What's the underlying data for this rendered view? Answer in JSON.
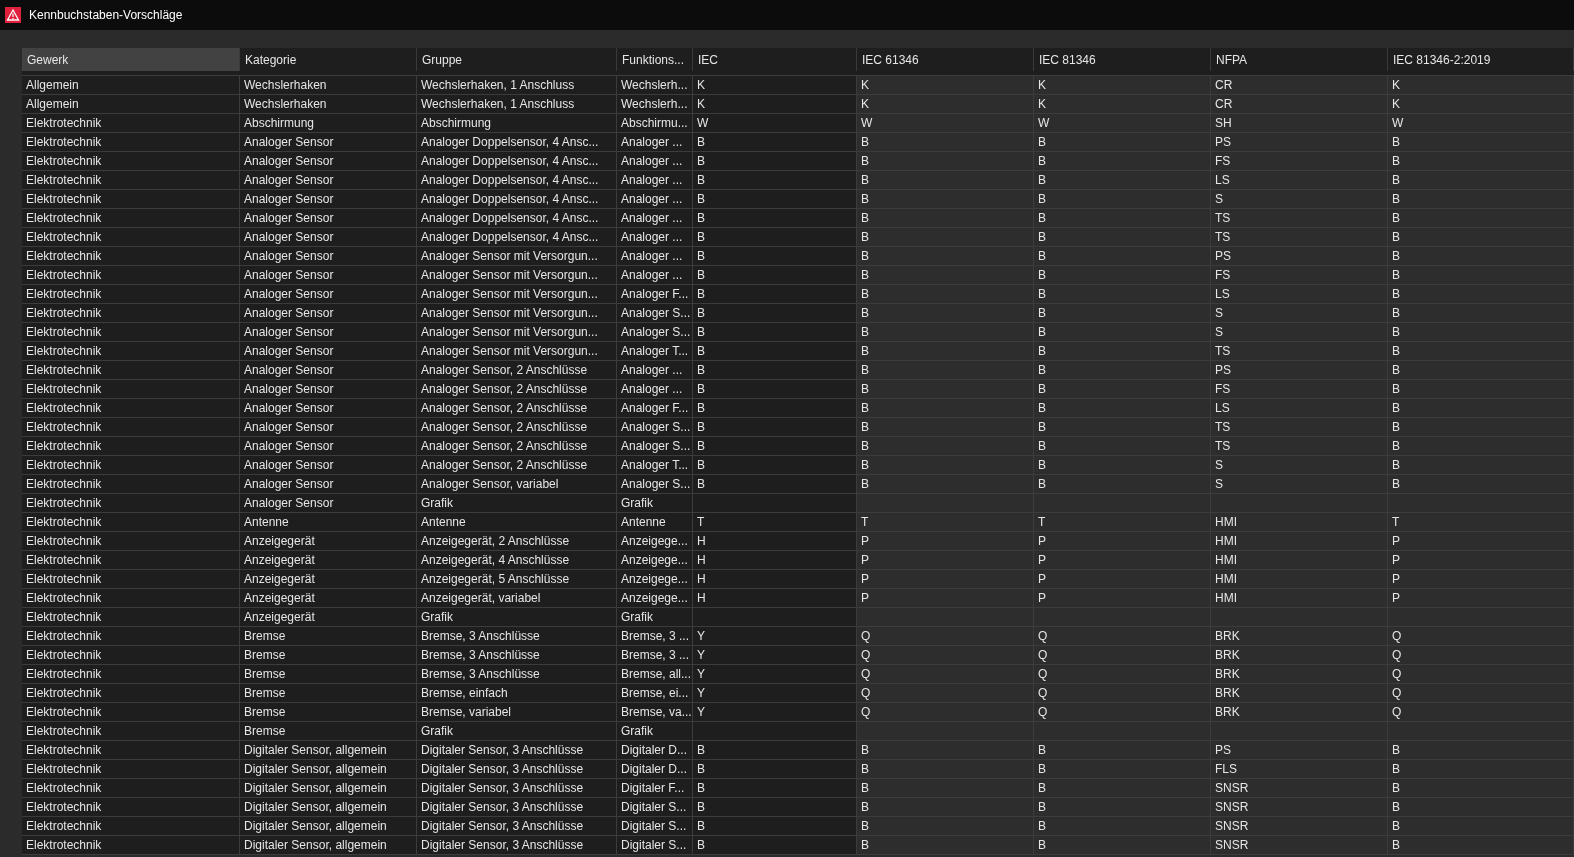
{
  "window": {
    "title": "Kennbuchstaben-Vorschläge"
  },
  "table": {
    "columns": [
      {
        "label": "Gewerk",
        "selected": true
      },
      {
        "label": "Kategorie",
        "selected": false
      },
      {
        "label": "Gruppe",
        "selected": false
      },
      {
        "label": "Funktions...",
        "selected": false
      },
      {
        "label": "IEC",
        "selected": false
      },
      {
        "label": "IEC 61346",
        "selected": false
      },
      {
        "label": "IEC 81346",
        "selected": false
      },
      {
        "label": "NFPA",
        "selected": false
      },
      {
        "label": "IEC 81346-2:2019",
        "selected": false
      }
    ],
    "rows": [
      [
        "Allgemein",
        "Wechslerhaken",
        "Wechslerhaken, 1 Anschluss",
        "Wechslerh...",
        "K",
        "K",
        "K",
        "CR",
        "K"
      ],
      [
        "Allgemein",
        "Wechslerhaken",
        "Wechslerhaken, 1 Anschluss",
        "Wechslerh...",
        "K",
        "K",
        "K",
        "CR",
        "K"
      ],
      [
        "Elektrotechnik",
        "Abschirmung",
        "Abschirmung",
        "Abschirmu...",
        "W",
        "W",
        "W",
        "SH",
        "W"
      ],
      [
        "Elektrotechnik",
        "Analoger Sensor",
        "Analoger Doppelsensor, 4 Ansc...",
        "Analoger ...",
        "B",
        "B",
        "B",
        "PS",
        "B"
      ],
      [
        "Elektrotechnik",
        "Analoger Sensor",
        "Analoger Doppelsensor, 4 Ansc...",
        "Analoger ...",
        "B",
        "B",
        "B",
        "FS",
        "B"
      ],
      [
        "Elektrotechnik",
        "Analoger Sensor",
        "Analoger Doppelsensor, 4 Ansc...",
        "Analoger ...",
        "B",
        "B",
        "B",
        "LS",
        "B"
      ],
      [
        "Elektrotechnik",
        "Analoger Sensor",
        "Analoger Doppelsensor, 4 Ansc...",
        "Analoger ...",
        "B",
        "B",
        "B",
        "S",
        "B"
      ],
      [
        "Elektrotechnik",
        "Analoger Sensor",
        "Analoger Doppelsensor, 4 Ansc...",
        "Analoger ...",
        "B",
        "B",
        "B",
        "TS",
        "B"
      ],
      [
        "Elektrotechnik",
        "Analoger Sensor",
        "Analoger Doppelsensor, 4 Ansc...",
        "Analoger ...",
        "B",
        "B",
        "B",
        "TS",
        "B"
      ],
      [
        "Elektrotechnik",
        "Analoger Sensor",
        "Analoger Sensor mit Versorgun...",
        "Analoger ...",
        "B",
        "B",
        "B",
        "PS",
        "B"
      ],
      [
        "Elektrotechnik",
        "Analoger Sensor",
        "Analoger Sensor mit Versorgun...",
        "Analoger ...",
        "B",
        "B",
        "B",
        "FS",
        "B"
      ],
      [
        "Elektrotechnik",
        "Analoger Sensor",
        "Analoger Sensor mit Versorgun...",
        "Analoger F...",
        "B",
        "B",
        "B",
        "LS",
        "B"
      ],
      [
        "Elektrotechnik",
        "Analoger Sensor",
        "Analoger Sensor mit Versorgun...",
        "Analoger S...",
        "B",
        "B",
        "B",
        "S",
        "B"
      ],
      [
        "Elektrotechnik",
        "Analoger Sensor",
        "Analoger Sensor mit Versorgun...",
        "Analoger S...",
        "B",
        "B",
        "B",
        "S",
        "B"
      ],
      [
        "Elektrotechnik",
        "Analoger Sensor",
        "Analoger Sensor mit Versorgun...",
        "Analoger T...",
        "B",
        "B",
        "B",
        "TS",
        "B"
      ],
      [
        "Elektrotechnik",
        "Analoger Sensor",
        "Analoger Sensor, 2 Anschlüsse",
        "Analoger ...",
        "B",
        "B",
        "B",
        "PS",
        "B"
      ],
      [
        "Elektrotechnik",
        "Analoger Sensor",
        "Analoger Sensor, 2 Anschlüsse",
        "Analoger ...",
        "B",
        "B",
        "B",
        "FS",
        "B"
      ],
      [
        "Elektrotechnik",
        "Analoger Sensor",
        "Analoger Sensor, 2 Anschlüsse",
        "Analoger F...",
        "B",
        "B",
        "B",
        "LS",
        "B"
      ],
      [
        "Elektrotechnik",
        "Analoger Sensor",
        "Analoger Sensor, 2 Anschlüsse",
        "Analoger S...",
        "B",
        "B",
        "B",
        "TS",
        "B"
      ],
      [
        "Elektrotechnik",
        "Analoger Sensor",
        "Analoger Sensor, 2 Anschlüsse",
        "Analoger S...",
        "B",
        "B",
        "B",
        "TS",
        "B"
      ],
      [
        "Elektrotechnik",
        "Analoger Sensor",
        "Analoger Sensor, 2 Anschlüsse",
        "Analoger T...",
        "B",
        "B",
        "B",
        "S",
        "B"
      ],
      [
        "Elektrotechnik",
        "Analoger Sensor",
        "Analoger Sensor, variabel",
        "Analoger S...",
        "B",
        "B",
        "B",
        "S",
        "B"
      ],
      [
        "Elektrotechnik",
        "Analoger Sensor",
        "Grafik",
        "Grafik",
        null,
        null,
        null,
        null,
        null
      ],
      [
        "Elektrotechnik",
        "Antenne",
        "Antenne",
        "Antenne",
        "T",
        "T",
        "T",
        "HMI",
        "T"
      ],
      [
        "Elektrotechnik",
        "Anzeigegerät",
        "Anzeigegerät, 2 Anschlüsse",
        "Anzeigege...",
        "H",
        "P",
        "P",
        "HMI",
        "P"
      ],
      [
        "Elektrotechnik",
        "Anzeigegerät",
        "Anzeigegerät, 4 Anschlüsse",
        "Anzeigege...",
        "H",
        "P",
        "P",
        "HMI",
        "P"
      ],
      [
        "Elektrotechnik",
        "Anzeigegerät",
        "Anzeigegerät, 5 Anschlüsse",
        "Anzeigege...",
        "H",
        "P",
        "P",
        "HMI",
        "P"
      ],
      [
        "Elektrotechnik",
        "Anzeigegerät",
        "Anzeigegerät, variabel",
        "Anzeigege...",
        "H",
        "P",
        "P",
        "HMI",
        "P"
      ],
      [
        "Elektrotechnik",
        "Anzeigegerät",
        "Grafik",
        "Grafik",
        null,
        null,
        null,
        null,
        null
      ],
      [
        "Elektrotechnik",
        "Bremse",
        "Bremse, 3 Anschlüsse",
        "Bremse, 3 ...",
        "Y",
        "Q",
        "Q",
        "BRK",
        "Q"
      ],
      [
        "Elektrotechnik",
        "Bremse",
        "Bremse, 3 Anschlüsse",
        "Bremse, 3 ...",
        "Y",
        "Q",
        "Q",
        "BRK",
        "Q"
      ],
      [
        "Elektrotechnik",
        "Bremse",
        "Bremse, 3 Anschlüsse",
        "Bremse, all...",
        "Y",
        "Q",
        "Q",
        "BRK",
        "Q"
      ],
      [
        "Elektrotechnik",
        "Bremse",
        "Bremse, einfach",
        "Bremse, ei...",
        "Y",
        "Q",
        "Q",
        "BRK",
        "Q"
      ],
      [
        "Elektrotechnik",
        "Bremse",
        "Bremse, variabel",
        "Bremse, va...",
        "Y",
        "Q",
        "Q",
        "BRK",
        "Q"
      ],
      [
        "Elektrotechnik",
        "Bremse",
        "Grafik",
        "Grafik",
        null,
        null,
        null,
        null,
        null
      ],
      [
        "Elektrotechnik",
        "Digitaler Sensor, allgemein",
        "Digitaler Sensor, 3 Anschlüsse",
        "Digitaler D...",
        "B",
        "B",
        "B",
        "PS",
        "B"
      ],
      [
        "Elektrotechnik",
        "Digitaler Sensor, allgemein",
        "Digitaler Sensor, 3 Anschlüsse",
        "Digitaler D...",
        "B",
        "B",
        "B",
        "FLS",
        "B"
      ],
      [
        "Elektrotechnik",
        "Digitaler Sensor, allgemein",
        "Digitaler Sensor, 3 Anschlüsse",
        "Digitaler F...",
        "B",
        "B",
        "B",
        "SNSR",
        "B"
      ],
      [
        "Elektrotechnik",
        "Digitaler Sensor, allgemein",
        "Digitaler Sensor, 3 Anschlüsse",
        "Digitaler S...",
        "B",
        "B",
        "B",
        "SNSR",
        "B"
      ],
      [
        "Elektrotechnik",
        "Digitaler Sensor, allgemein",
        "Digitaler Sensor, 3 Anschlüsse",
        "Digitaler S...",
        "B",
        "B",
        "B",
        "SNSR",
        "B"
      ],
      [
        "Elektrotechnik",
        "Digitaler Sensor, allgemein",
        "Digitaler Sensor, 3 Anschlüsse",
        "Digitaler S...",
        "B",
        "B",
        "B",
        "SNSR",
        "B"
      ]
    ]
  }
}
